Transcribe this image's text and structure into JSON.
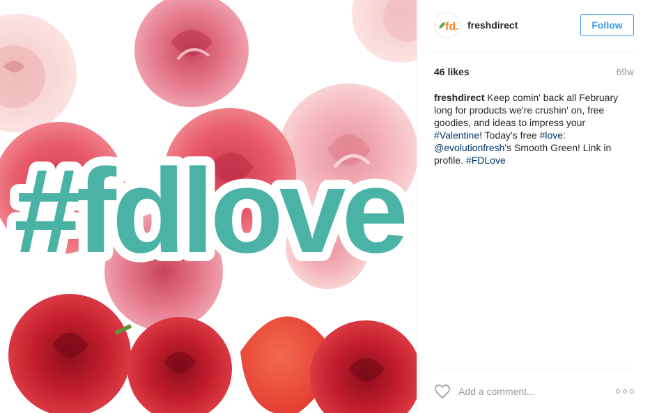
{
  "post": {
    "author": "freshdirect",
    "follow_label": "Follow",
    "likes": "46 likes",
    "time_ago": "69w",
    "avatar_initials": "fd."
  },
  "media": {
    "hashtag_text": "#fdlove"
  },
  "caption": {
    "user": "freshdirect",
    "part1": " Keep comin' back all February long for products we're crushin' on, free goodies, and ideas to impress your ",
    "tag1": "#Valentine",
    "part2": "! Today's free ",
    "tag2": "#love",
    "part3": ": ",
    "mention": "@evolutionfresh",
    "part4": "'s Smooth Green! Link in profile. ",
    "tag3": "#FDLove"
  },
  "comment": {
    "placeholder": "Add a comment..."
  },
  "colors": {
    "accent_blue": "#3897f0",
    "hashtag_blue": "#003569",
    "brand_teal": "#4bb3a5",
    "brand_orange": "#f5821f",
    "brand_green": "#6aa84f"
  },
  "icons": {
    "like": "heart-outline-icon",
    "more": "more-options-icon"
  }
}
